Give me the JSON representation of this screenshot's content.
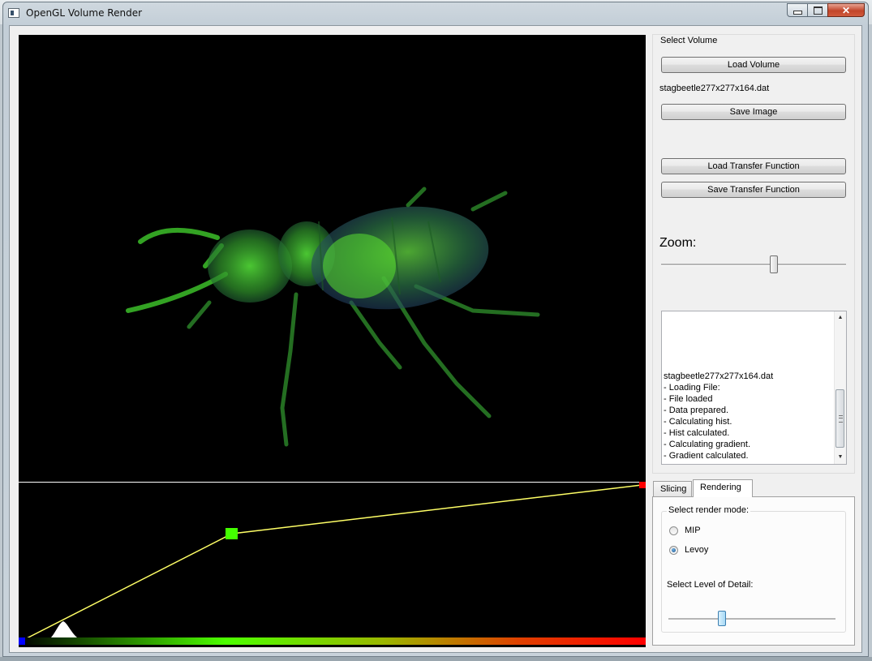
{
  "window": {
    "title": "OpenGL Volume Render",
    "controls": {
      "minimize_icon": "minimize-icon",
      "maximize_icon": "maximize-icon",
      "close_icon": "close-icon"
    }
  },
  "volume_panel": {
    "group_title": "Select Volume",
    "load_volume": "Load Volume",
    "filename": "stagbeetle277x277x164.dat",
    "save_image": "Save Image",
    "load_tf": "Load Transfer Function",
    "save_tf": "Save Transfer Function",
    "zoom_label": "Zoom:",
    "zoom_value": 0.6
  },
  "log": {
    "lines": [
      "stagbeetle277x277x164.dat",
      "- Loading File:",
      "- File loaded",
      "- Data prepared.",
      "- Calculating hist.",
      "- Hist calculated.",
      "- Calculating gradient.",
      "- Gradient calculated."
    ]
  },
  "tabs": [
    {
      "label": "Slicing",
      "active": false
    },
    {
      "label": "Rendering",
      "active": true
    }
  ],
  "rendering_tab": {
    "mode_title": "Select render mode:",
    "modes": [
      {
        "label": "MIP",
        "checked": false
      },
      {
        "label": "Levoy",
        "checked": true
      }
    ],
    "lod_label": "Select Level of Detail:",
    "lod_value": 0.3
  },
  "colors": {
    "tf_line": "#ffff66",
    "node_green": "#44ff00",
    "node_red": "#ff0000",
    "node_blue": "#0000ff",
    "beetle": "#3fbf2a"
  }
}
